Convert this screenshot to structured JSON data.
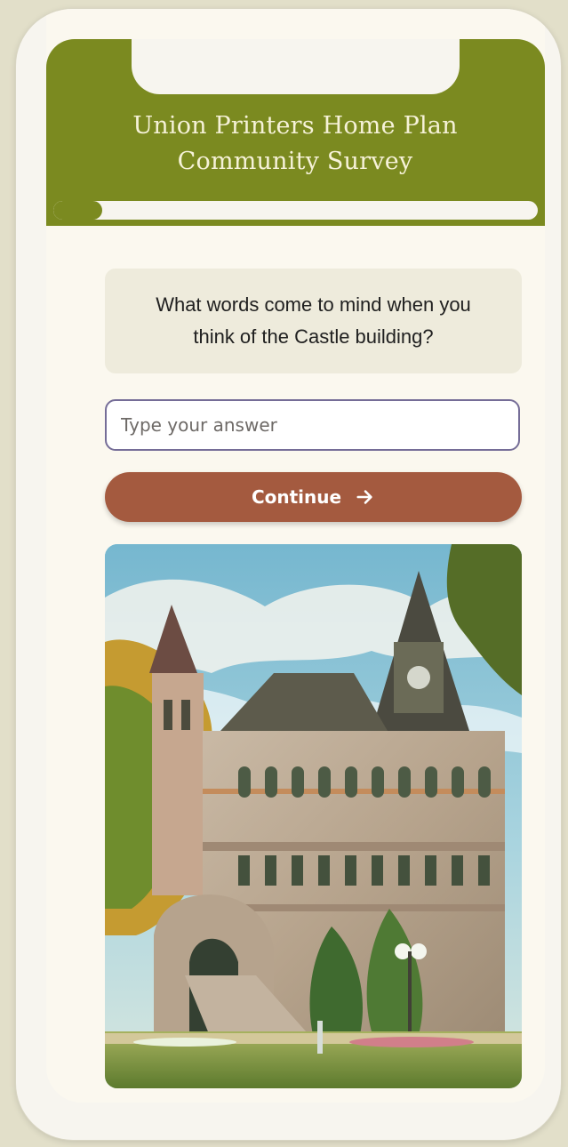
{
  "header": {
    "title_line1": "Union Printers Home Plan",
    "title_line2": "Community Survey"
  },
  "progress": {
    "value": 0.1
  },
  "question": {
    "text": "What words come to mind when you think of the Castle building?"
  },
  "answer": {
    "placeholder": "Type your answer",
    "value": ""
  },
  "actions": {
    "continue_label": "Continue"
  },
  "colors": {
    "brand": "#7b8a20",
    "accent": "#a45a3f",
    "background": "#e2dfc9",
    "screen": "#fbf8ef",
    "input_border": "#756d97"
  },
  "icons": {
    "continue": "arrow-right-icon"
  }
}
